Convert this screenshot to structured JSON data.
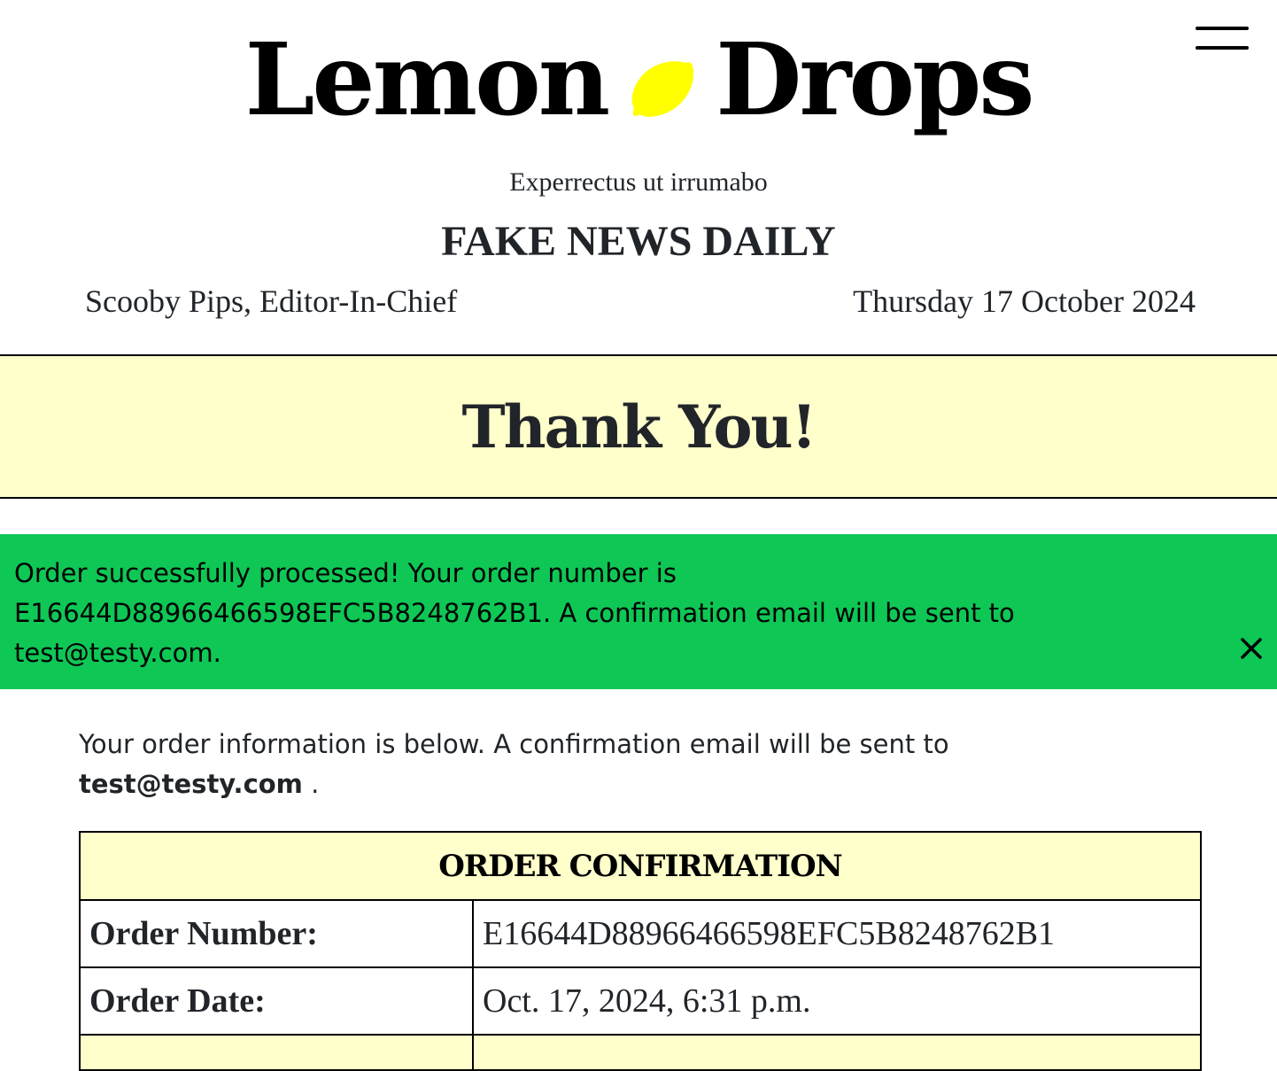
{
  "header": {
    "logo_left": "Lemon",
    "logo_right": "Drops",
    "lemon_color": "#ffff00",
    "tagline": "Experrectus ut irrumabo",
    "paper_name": "FAKE NEWS DAILY",
    "editor": "Scooby Pips, Editor-In-Chief",
    "date": "Thursday 17 October 2024"
  },
  "page": {
    "title": "Thank You!",
    "band_color": "#ffffcc"
  },
  "alert": {
    "message": "Order successfully processed! Your order number is E16644D88966466598EFC5B8248762B1. A confirmation email will be sent to test@testy.com.",
    "color": "#0ec755",
    "close_icon": "close-icon"
  },
  "intro": {
    "text": "Your order information is below. A confirmation email will be sent to",
    "email": "test@testy.com",
    "end": "."
  },
  "order": {
    "heading": "ORDER CONFIRMATION",
    "rows": [
      {
        "label": "Order Number:",
        "value": "E16644D88966466598EFC5B8248762B1"
      },
      {
        "label": "Order Date:",
        "value": "Oct. 17, 2024, 6:31 p.m."
      }
    ]
  }
}
